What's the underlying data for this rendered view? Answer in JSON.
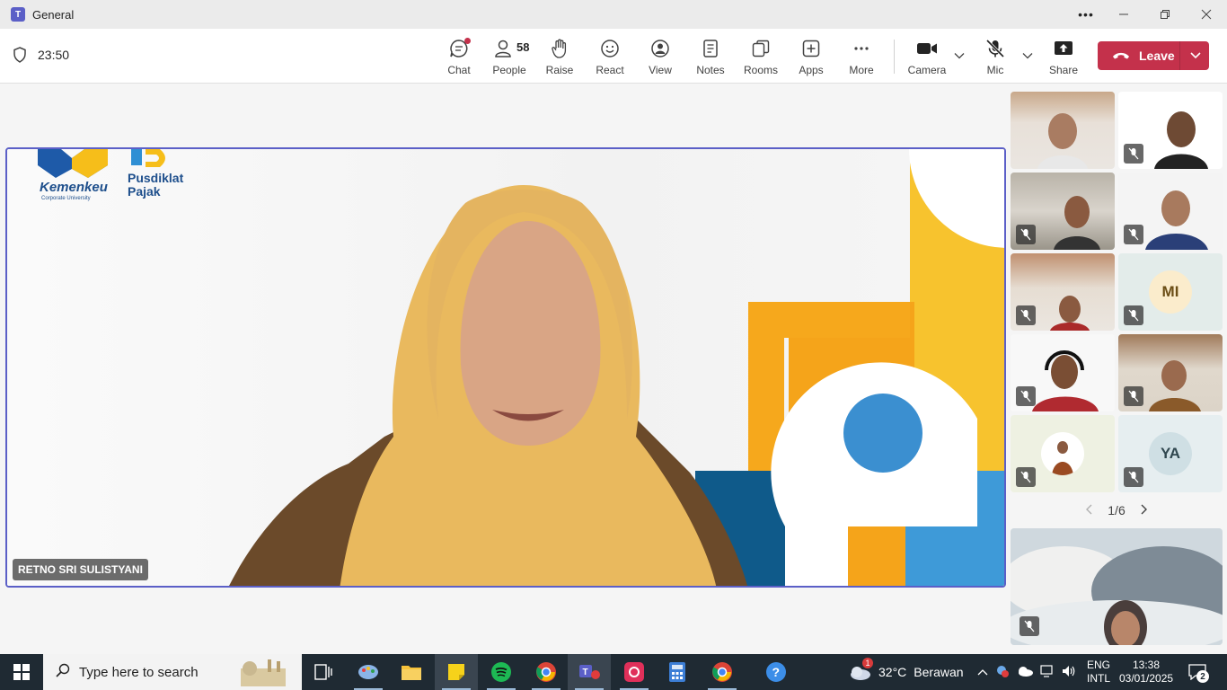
{
  "window": {
    "title": "General"
  },
  "toolbar": {
    "timer": "23:50",
    "chat_label": "Chat",
    "people_label": "People",
    "people_count": "58",
    "raise_label": "Raise",
    "react_label": "React",
    "view_label": "View",
    "notes_label": "Notes",
    "rooms_label": "Rooms",
    "apps_label": "Apps",
    "more_label": "More",
    "camera_label": "Camera",
    "mic_label": "Mic",
    "share_label": "Share",
    "leave_label": "Leave"
  },
  "stage": {
    "speaker_name": "RETNO SRI SULISTYANI",
    "logo_left": "Kemenkeu",
    "logo_left_sub": "Corporate University",
    "logo_right": "Pusdiklat",
    "logo_right_2": "Pajak"
  },
  "gallery": {
    "tiles": [
      {
        "initials": ""
      },
      {
        "initials": ""
      },
      {
        "initials": ""
      },
      {
        "initials": ""
      },
      {
        "initials": ""
      },
      {
        "initials": "MI"
      },
      {
        "initials": ""
      },
      {
        "initials": ""
      },
      {
        "initials": ""
      },
      {
        "initials": "YA"
      }
    ],
    "page": "1/6"
  },
  "taskbar": {
    "search_placeholder": "Type here to search",
    "weather_temp": "32°C",
    "weather_text": "Berawan",
    "lang_1": "ENG",
    "lang_2": "INTL",
    "time": "13:38",
    "date": "03/01/2025",
    "notifications": "2",
    "weather_badge": "1"
  },
  "colors": {
    "accent": "#5b5fc7",
    "leave": "#c4314b",
    "taskbar": "#1f2a33"
  }
}
